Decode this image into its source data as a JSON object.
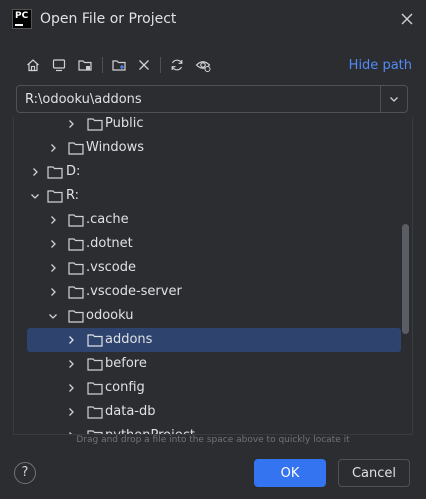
{
  "window": {
    "logo_text": "PC",
    "title": "Open File or Project"
  },
  "toolbar": {
    "buttons": [
      "home-icon",
      "desktop-icon",
      "project-folder-icon",
      "new-folder-icon",
      "delete-icon",
      "refresh-icon",
      "show-hidden-icon"
    ],
    "hide_path_label": "Hide path"
  },
  "path": {
    "value": "R:\\odooku\\addons"
  },
  "tree": {
    "items": [
      {
        "label": "Public",
        "expanded": false,
        "folder": true
      },
      {
        "label": "Windows",
        "expanded": false,
        "folder": true
      },
      {
        "label": "D:",
        "expanded": false,
        "folder": false
      },
      {
        "label": "R:",
        "expanded": true,
        "folder": false
      },
      {
        "label": ".cache",
        "expanded": false,
        "folder": true
      },
      {
        "label": ".dotnet",
        "expanded": false,
        "folder": true
      },
      {
        "label": ".vscode",
        "expanded": false,
        "folder": true
      },
      {
        "label": ".vscode-server",
        "expanded": false,
        "folder": true
      },
      {
        "label": "odooku",
        "expanded": true,
        "folder": true
      },
      {
        "label": "addons",
        "expanded": false,
        "folder": true,
        "selected": true
      },
      {
        "label": "before",
        "expanded": false,
        "folder": true
      },
      {
        "label": "config",
        "expanded": false,
        "folder": true
      },
      {
        "label": "data-db",
        "expanded": false,
        "folder": true
      },
      {
        "label": "pythonProject",
        "expanded": false,
        "folder": true
      }
    ]
  },
  "footer": {
    "hint": "Drag and drop a file into the space above to quickly locate it",
    "help_label": "?",
    "ok_label": "OK",
    "cancel_label": "Cancel"
  },
  "colors": {
    "background": "#2b2d30",
    "accent": "#3574f0",
    "selection": "#2e436e",
    "link": "#548af7"
  }
}
